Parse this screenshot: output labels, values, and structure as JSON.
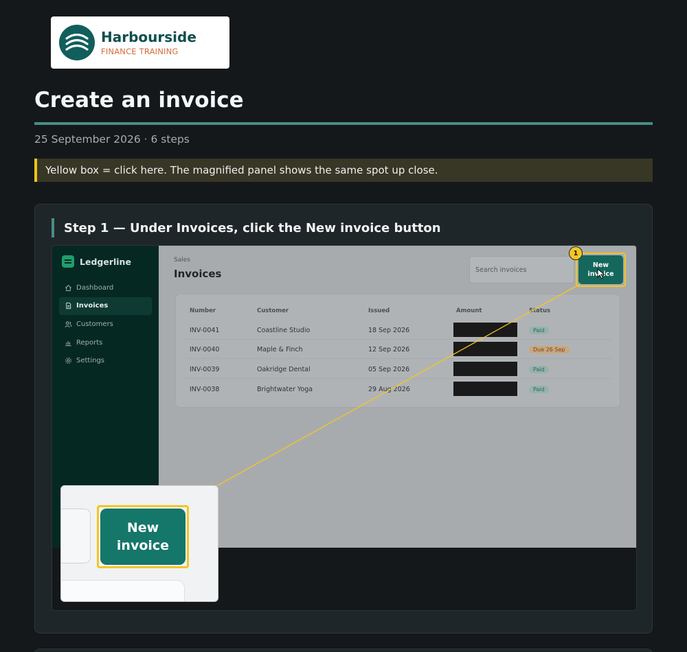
{
  "brand": {
    "name": "Harbourside",
    "tagline": "FINANCE TRAINING",
    "logo_icon": "arcs-logo-icon",
    "colors": {
      "primary": "#125e5c",
      "accent": "#d36a3c"
    }
  },
  "guide": {
    "title": "Create an invoice",
    "meta": "25 September 2026 · 6 steps",
    "tip": "Yellow box = click here. The magnified panel shows the same spot up close."
  },
  "step": {
    "heading": "Step 1 — Under Invoices, click the New invoice button",
    "callout_number": "1",
    "highlight_color": "#f3c623"
  },
  "app": {
    "name": "Ledgerline",
    "nav": [
      {
        "label": "Dashboard",
        "icon": "home-icon",
        "active": false
      },
      {
        "label": "Invoices",
        "icon": "document-icon",
        "active": true
      },
      {
        "label": "Customers",
        "icon": "users-icon",
        "active": false
      },
      {
        "label": "Reports",
        "icon": "bar-chart-icon",
        "active": false
      },
      {
        "label": "Settings",
        "icon": "gear-icon",
        "active": false
      }
    ],
    "breadcrumb": "Sales",
    "heading": "Invoices",
    "search_placeholder": "Search invoices",
    "new_button": "New invoice",
    "table": {
      "columns": [
        "Number",
        "Customer",
        "Issued",
        "Amount",
        "Status"
      ],
      "rows": [
        {
          "number": "INV-0041",
          "customer": "Coastline Studio",
          "issued": "18 Sep 2026",
          "amount": "",
          "status": "Paid",
          "status_type": "paid"
        },
        {
          "number": "INV-0040",
          "customer": "Maple & Finch",
          "issued": "12 Sep 2026",
          "amount": "",
          "status": "Due 26 Sep",
          "status_type": "due"
        },
        {
          "number": "INV-0039",
          "customer": "Oakridge Dental",
          "issued": "05 Sep 2026",
          "amount": "",
          "status": "Paid",
          "status_type": "paid"
        },
        {
          "number": "INV-0038",
          "customer": "Brightwater Yoga",
          "issued": "29 Aug 2026",
          "amount": "",
          "status": "Paid",
          "status_type": "paid"
        }
      ]
    }
  },
  "magnifier": {
    "button_line1": "New",
    "button_line2": "invoice"
  }
}
